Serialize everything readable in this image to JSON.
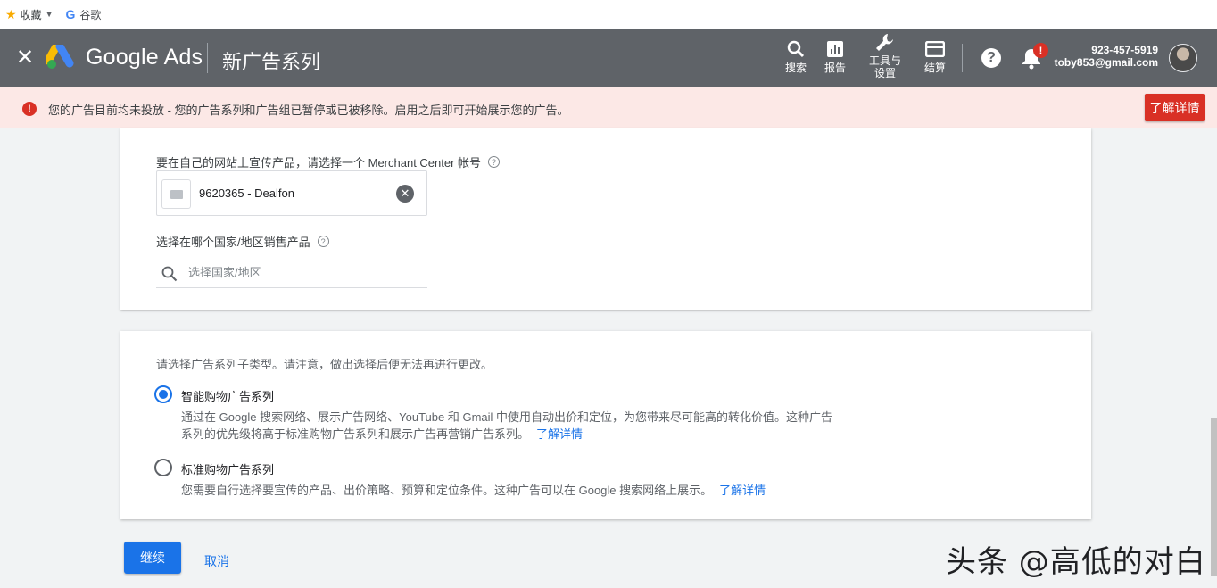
{
  "bookmarks": {
    "favorites_label": "收藏",
    "google_label": "谷歌"
  },
  "header": {
    "brand": "Google Ads",
    "page_title": "新广告系列",
    "tools": {
      "search": "搜索",
      "reports": "报告",
      "tools_line1": "工具与",
      "tools_line2": "设置",
      "billing": "结算"
    },
    "notification_badge": "!",
    "account_phone": "923-457-5919",
    "account_email": "toby853@gmail.com"
  },
  "alert": {
    "message": "您的广告目前均未投放 - 您的广告系列和广告组已暂停或已被移除。启用之后即可开始展示您的广告。",
    "learn_more": "了解详情",
    "color": "#d93025"
  },
  "merchant_section": {
    "label": "要在自己的网站上宣传产品，请选择一个 Merchant Center 帐号",
    "selected_account": "9620365 - Dealfon",
    "country_label": "选择在哪个国家/地区销售产品",
    "country_placeholder": "选择国家/地区"
  },
  "subtype_section": {
    "intro": "请选择广告系列子类型。请注意，做出选择后便无法再进行更改。",
    "options": [
      {
        "title": "智能购物广告系列",
        "desc_line1": "通过在 Google 搜索网络、展示广告网络、YouTube 和 Gmail 中使用自动出价和定位，为您带来尽可能高的转化价值。这种广告",
        "desc_line2": "系列的优先级将高于标准购物广告系列和展示广告再营销广告系列。",
        "link": "了解详情",
        "selected": true
      },
      {
        "title": "标准购物广告系列",
        "desc_line1": "您需要自行选择要宣传的产品、出价策略、预算和定位条件。这种广告可以在 Google 搜索网络上展示。",
        "link": "了解详情",
        "selected": false
      }
    ]
  },
  "actions": {
    "continue": "继续",
    "cancel": "取消"
  },
  "watermark": "头条 @高低的对白",
  "colors": {
    "header_bg": "#5f6368",
    "primary": "#1a73e8",
    "alert_bg": "#fce8e6"
  }
}
